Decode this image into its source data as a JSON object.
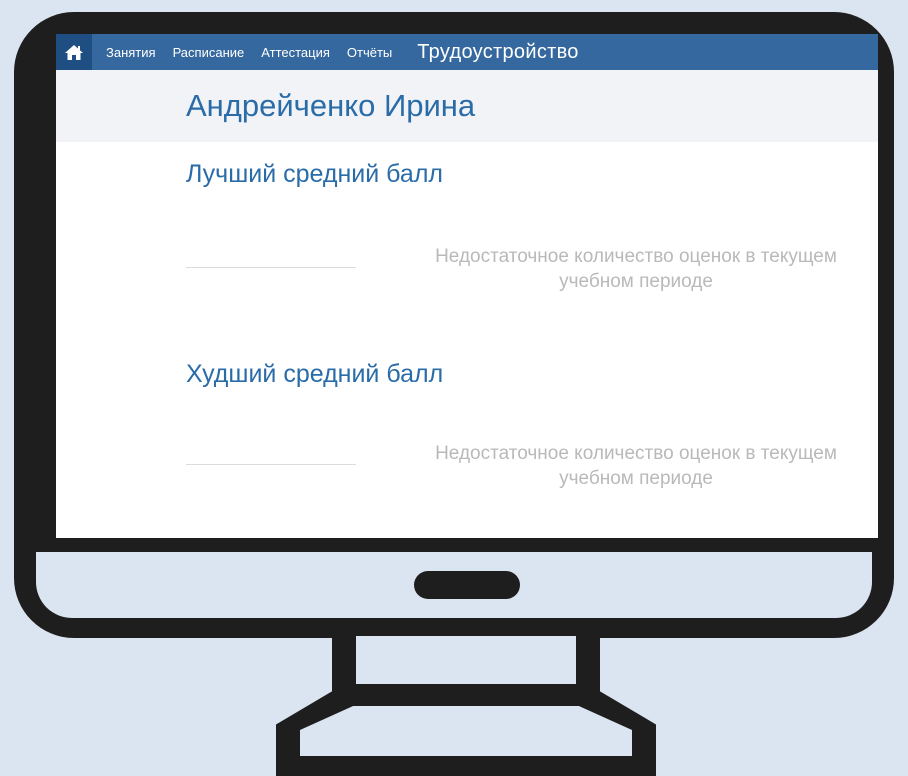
{
  "navbar": {
    "home_icon": "home-icon",
    "items": [
      {
        "label": "Занятия"
      },
      {
        "label": "Расписание"
      },
      {
        "label": "Аттестация"
      },
      {
        "label": "Отчёты"
      },
      {
        "label": "Трудоустройство",
        "active": true
      }
    ]
  },
  "student": {
    "name": "Андрейченко Ирина"
  },
  "sections": {
    "best": {
      "title": "Лучший средний балл",
      "note": "Недостаточное количество оценок в текущем учебном периоде"
    },
    "worst": {
      "title": "Худший средний балл",
      "note": "Недостаточное количество оценок в текущем учебном периоде"
    }
  },
  "colors": {
    "navbar": "#35689e",
    "accent_text": "#2a6ca8",
    "muted_text": "#b9b9b9",
    "background": "#dbe5f1",
    "monitor": "#1e1e1e"
  }
}
